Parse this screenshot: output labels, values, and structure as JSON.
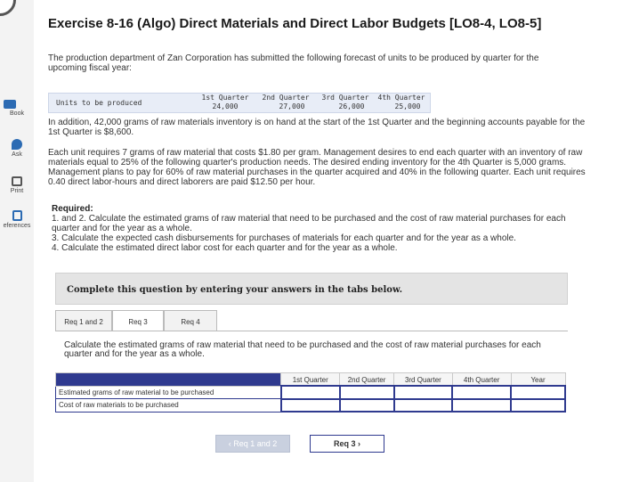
{
  "sidebar": {
    "items": [
      {
        "label": "Book",
        "icon": "book-icon"
      },
      {
        "label": "Ask",
        "icon": "ask-icon"
      },
      {
        "label": "Print",
        "icon": "print-icon"
      },
      {
        "label": "eferences",
        "icon": "references-icon"
      }
    ]
  },
  "title": "Exercise 8-16 (Algo) Direct Materials and Direct Labor Budgets [LO8-4, LO8-5]",
  "intro": "The production department of Zan Corporation has submitted the following forecast of units to be produced by quarter for the upcoming fiscal year:",
  "forecast": {
    "label": "Units to be produced",
    "quarters": [
      {
        "name": "1st Quarter",
        "value": "24,000"
      },
      {
        "name": "2nd Quarter",
        "value": "27,000"
      },
      {
        "name": "3rd Quarter",
        "value": "26,000"
      },
      {
        "name": "4th Quarter",
        "value": "25,000"
      }
    ]
  },
  "paragraph2": "In addition, 42,000 grams of raw materials inventory is on hand at the start of the 1st Quarter and the beginning accounts payable for the 1st Quarter is $8,600.",
  "paragraph3": "Each unit requires 7 grams of raw material that costs $1.80 per gram. Management desires to end each quarter with an inventory of raw materials equal to 25% of the following quarter's production needs. The desired ending inventory for the 4th Quarter is 5,000 grams. Management plans to pay for 60% of raw material purchases in the quarter acquired and 40% in the following quarter. Each unit requires 0.40 direct labor-hours and direct laborers are paid $12.50 per hour.",
  "required": {
    "heading": "Required:",
    "items": [
      "1. and 2. Calculate the estimated grams of raw material that need to be purchased and the cost of raw material purchases for each quarter and for the year as a whole.",
      "3. Calculate the expected cash disbursements for purchases of materials for each quarter and for the year as a whole.",
      "4. Calculate the estimated direct labor cost for each quarter and for the year as a whole."
    ]
  },
  "panel_text": "Complete this question by entering your answers in the tabs below.",
  "tabs": [
    "Req 1 and 2",
    "Req 3",
    "Req 4"
  ],
  "instruction": "Calculate the estimated grams of raw material that need to be purchased and the cost of raw material purchases for each quarter and for the year as a whole.",
  "answer_table": {
    "columns": [
      "1st Quarter",
      "2nd Quarter",
      "3rd Quarter",
      "4th Quarter",
      "Year"
    ],
    "rows": [
      "Estimated grams of raw material to be purchased",
      "Cost of raw materials to be purchased"
    ]
  },
  "nav": {
    "prev": "Req 1 and 2",
    "next": "Req 3"
  },
  "colors": {
    "accent": "#2f3a8f",
    "panel": "#e4e4e4",
    "forecast_bg": "#e8edf7"
  }
}
